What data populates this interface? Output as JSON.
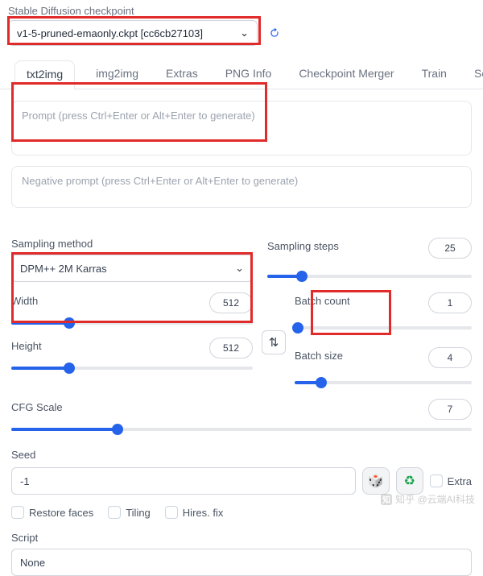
{
  "checkpoint": {
    "label": "Stable Diffusion checkpoint",
    "value": "v1-5-pruned-emaonly.ckpt [cc6cb27103]"
  },
  "tabs": [
    "txt2img",
    "img2img",
    "Extras",
    "PNG Info",
    "Checkpoint Merger",
    "Train",
    "Settings"
  ],
  "activeTab": 0,
  "prompt": {
    "placeholder": "Prompt (press Ctrl+Enter or Alt+Enter to generate)",
    "value": ""
  },
  "negativePrompt": {
    "placeholder": "Negative prompt (press Ctrl+Enter or Alt+Enter to generate)",
    "value": ""
  },
  "sampling": {
    "methodLabel": "Sampling method",
    "methodValue": "DPM++ 2M Karras",
    "stepsLabel": "Sampling steps",
    "stepsValue": "25",
    "stepsFillPct": 17
  },
  "width": {
    "label": "Width",
    "value": "512",
    "fillPct": 24
  },
  "height": {
    "label": "Height",
    "value": "512",
    "fillPct": 24
  },
  "batchCount": {
    "label": "Batch count",
    "value": "1",
    "fillPct": 2
  },
  "batchSize": {
    "label": "Batch size",
    "value": "4",
    "fillPct": 15
  },
  "cfg": {
    "label": "CFG Scale",
    "value": "7",
    "fillPct": 23
  },
  "seed": {
    "label": "Seed",
    "value": "-1",
    "extraLabel": "Extra"
  },
  "checks": {
    "restoreFaces": "Restore faces",
    "tiling": "Tiling",
    "hiresFix": "Hires. fix"
  },
  "script": {
    "label": "Script",
    "value": "None"
  },
  "watermark": "知乎 @云端AI科技"
}
